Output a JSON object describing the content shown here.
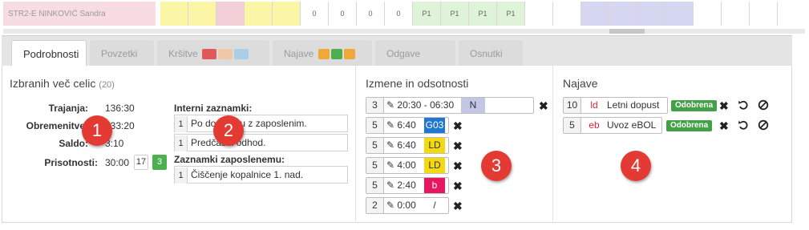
{
  "top_strip": {
    "employee_name": "STR2-E NINKOVIĆ Sandra",
    "cells": [
      "",
      "",
      "",
      "",
      "",
      "0",
      "0",
      "0",
      "0",
      "P1",
      "P1",
      "P1",
      "P1",
      "",
      "",
      "",
      "",
      "",
      "",
      "",
      "",
      "",
      ""
    ]
  },
  "tabs": [
    {
      "label": "Podrobnosti"
    },
    {
      "label": "Povzetki"
    },
    {
      "label": "Kršitve"
    },
    {
      "label": "Najave"
    },
    {
      "label": "Odgave"
    },
    {
      "label": "Osnutki"
    }
  ],
  "selection": {
    "title": "Izbranih več celic",
    "count": "(20)",
    "rows": [
      {
        "label": "Trajanja:",
        "value": "136:30"
      },
      {
        "label": "Obremenitve:",
        "value": "133:20"
      },
      {
        "label": "Saldo:",
        "value": "3:10"
      },
      {
        "label": "Prisotnosti:",
        "value": "30:00"
      }
    ],
    "presence_badges": [
      "17",
      "3"
    ]
  },
  "notes": {
    "internal_title": "Interni zaznamki:",
    "internal": [
      {
        "n": "1",
        "text": "Po dogovoru z zaposlenim."
      },
      {
        "n": "1",
        "text": "Predčasni odhod."
      }
    ],
    "employee_title": "Zaznamki zaposlenemu:",
    "employee": [
      {
        "n": "1",
        "text": "Čiščenje kopalnice 1. nad."
      }
    ]
  },
  "changes": {
    "title": "Izmene in odsotnosti",
    "items": [
      {
        "n": "3",
        "time": "20:30 - 06:30",
        "code": "N"
      },
      {
        "n": "5",
        "time": "6:40",
        "code": "G03"
      },
      {
        "n": "5",
        "time": "6:40",
        "code": "LD"
      },
      {
        "n": "5",
        "time": "4:00",
        "code": "LD"
      },
      {
        "n": "5",
        "time": "2:40",
        "code": "b"
      },
      {
        "n": "2",
        "time": "0:00",
        "code": "/"
      }
    ]
  },
  "announcements": {
    "title": "Najave",
    "items": [
      {
        "n": "10",
        "code": "ld",
        "desc": "Letni dopust",
        "status": "Odobrena"
      },
      {
        "n": "5",
        "code": "eb",
        "desc": "Uvoz eBOL",
        "status": "Odobrena"
      }
    ]
  },
  "markers": [
    "1",
    "2",
    "3",
    "4"
  ],
  "colors": {
    "blue_code": "#1f77d0",
    "yellow_code": "#f5d90f",
    "pink_code": "#e8175d",
    "approved_green": "#43a047",
    "marker_red": "#e33b34"
  }
}
